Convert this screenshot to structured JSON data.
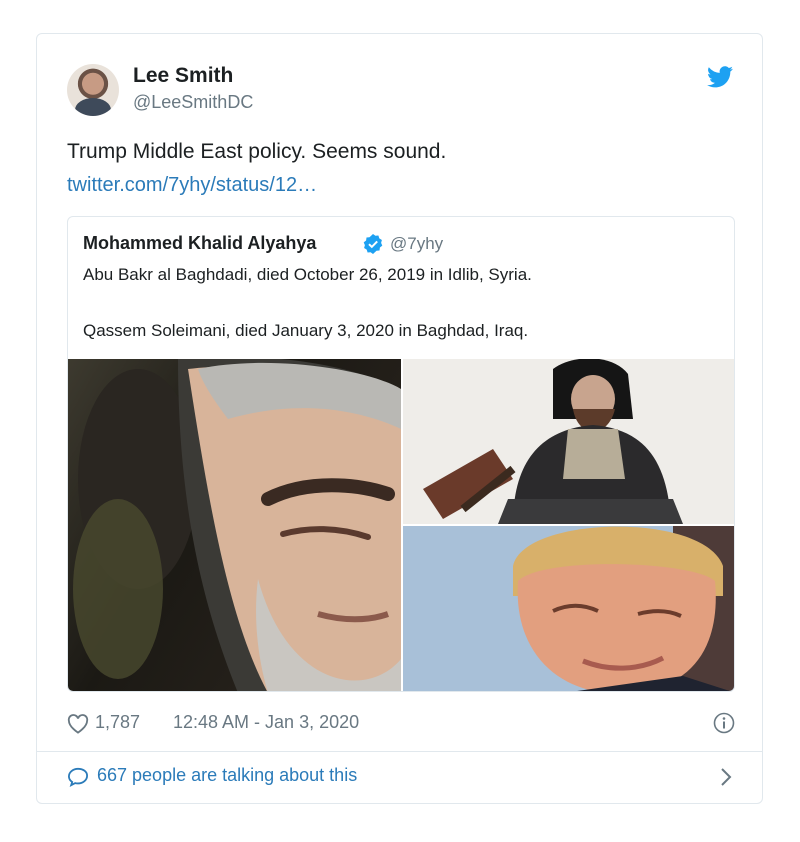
{
  "author": {
    "display_name": "Lee Smith",
    "handle": "@LeeSmithDC",
    "avatar_icon": "profile-photo"
  },
  "tweet": {
    "text": "Trump Middle East policy. Seems sound.",
    "link_text": "twitter.com/7yhy/status/12…"
  },
  "quoted_tweet": {
    "display_name": "Mohammed Khalid Alyahya",
    "handle": "@7yhy",
    "verified_icon": "verified-badge-icon",
    "line1": "Abu Bakr al Baghdadi, died October 26, 2019 in Idlib, Syria.",
    "line2": "Qassem Soleimani, died January 3, 2020 in Baghdad, Iraq."
  },
  "footer": {
    "likes": "1,787",
    "timestamp": "12:48 AM - Jan 3, 2020",
    "conversation": "667 people are talking about this"
  },
  "icons": {
    "brand": "twitter-bird-icon",
    "like": "heart-icon",
    "info": "info-icon",
    "reply": "speech-bubble-icon",
    "more": "chevron-right-icon"
  },
  "colors": {
    "brand_blue": "#1da1f2",
    "link_blue": "#2b7bb9",
    "secondary_text": "#697882",
    "border": "#e1e8ed"
  }
}
